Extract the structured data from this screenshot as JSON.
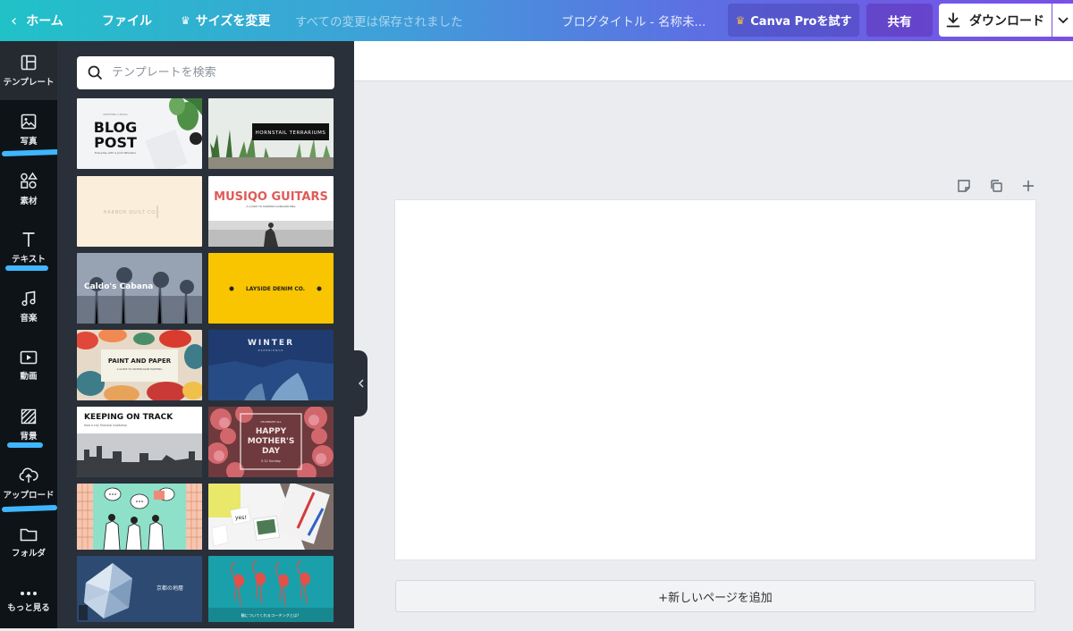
{
  "topbar": {
    "home_label": "ホーム",
    "file_label": "ファイル",
    "resize_label": "サイズを変更",
    "saved_status": "すべての変更は保存されました",
    "doc_title": "ブログタイトル - 名称未...",
    "pro_label": "Canva Proを試す",
    "share_label": "共有",
    "download_label": "ダウンロード"
  },
  "sidebar": {
    "items": [
      {
        "label": "テンプレート",
        "icon": "template-icon"
      },
      {
        "label": "写真",
        "icon": "photo-icon"
      },
      {
        "label": "素材",
        "icon": "elements-icon"
      },
      {
        "label": "テキスト",
        "icon": "text-icon"
      },
      {
        "label": "音楽",
        "icon": "music-icon"
      },
      {
        "label": "動画",
        "icon": "video-icon"
      },
      {
        "label": "背景",
        "icon": "background-icon"
      },
      {
        "label": "アップロード",
        "icon": "upload-icon"
      },
      {
        "label": "フォルダ",
        "icon": "folder-icon"
      },
      {
        "label": "もっと見る",
        "icon": "more-icon"
      }
    ],
    "highlight_color": "#3fb6ff"
  },
  "panel": {
    "search_placeholder": "テンプレートを検索",
    "templates": [
      {
        "title": "BLOG",
        "title2": "POST",
        "subtitle": "Everyday with a pink Whiskers",
        "kicker": "CREATING A BLOG"
      },
      {
        "title": "HORNSTAIL TERRARIUMS"
      },
      {
        "title": "HARBOR QUILT CO."
      },
      {
        "title": "MUSIQO GUITARS",
        "subtitle": "A GUIDE TO MODERN SONGWRITING"
      },
      {
        "title": "Caldo's Cabana"
      },
      {
        "title": "LAYSIDE DENIM CO."
      },
      {
        "title": "PAINT AND PAPER",
        "subtitle": "A GUIDE TO WATERCOLOR PAINTING"
      },
      {
        "title": "WINTER",
        "subtitle": "EXPERIENCE"
      },
      {
        "title": "KEEPING ON TRACK",
        "subtitle": "How a city financial institution"
      },
      {
        "title": "HAPPY",
        "title2": "MOTHER'S",
        "title3": "DAY",
        "kicker": "CELEBRATE ALL",
        "subtitle": "5.12 Sunday"
      },
      {
        "title": "",
        "subtitle": ""
      },
      {
        "title": "yes!"
      },
      {
        "title": "京都の地層"
      },
      {
        "title": "鶴についてくれるコーチングとは？"
      }
    ]
  },
  "canvas": {
    "add_page_label": "+新しいページを追加"
  }
}
